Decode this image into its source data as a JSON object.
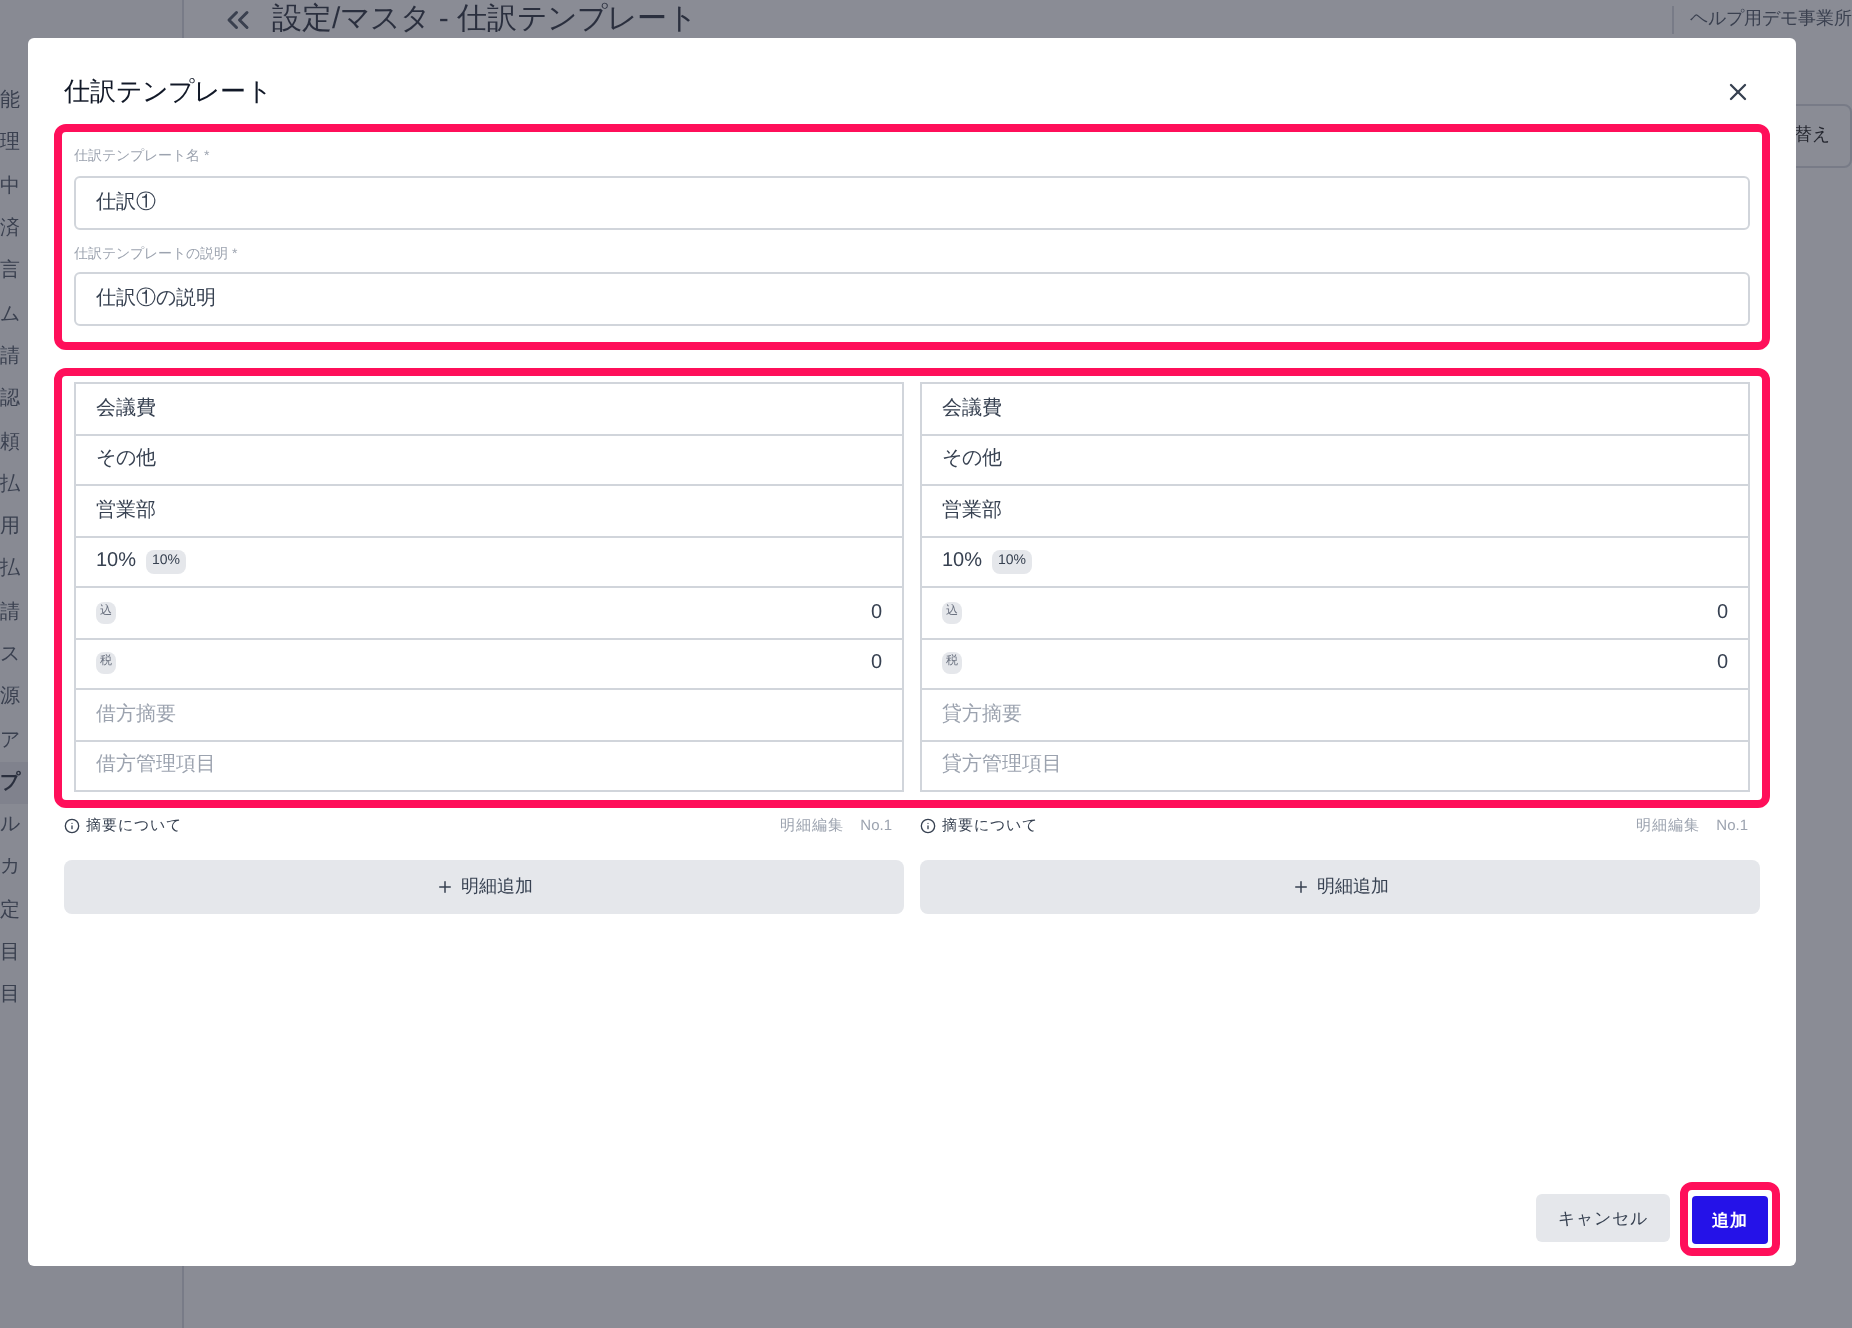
{
  "sidebar": {
    "items": [
      {
        "label": "能",
        "selected": false
      },
      {
        "label": "理",
        "selected": false
      },
      {
        "label": "中",
        "selected": false
      },
      {
        "label": "済",
        "selected": false
      },
      {
        "label": "言",
        "selected": false
      },
      {
        "label": "ム",
        "selected": false
      },
      {
        "label": "請",
        "selected": false
      },
      {
        "label": "認",
        "selected": false
      },
      {
        "label": "頼",
        "selected": false
      },
      {
        "label": "払",
        "selected": false
      },
      {
        "label": "用",
        "selected": false
      },
      {
        "label": "払",
        "selected": false
      },
      {
        "label": "請",
        "selected": false
      },
      {
        "label": "ス",
        "selected": false
      },
      {
        "label": "源",
        "selected": false
      },
      {
        "label": "ア",
        "selected": false
      },
      {
        "label": "プ",
        "selected": true
      },
      {
        "label": "ル",
        "selected": false
      },
      {
        "label": "カ",
        "selected": false
      },
      {
        "label": "定",
        "selected": false
      },
      {
        "label": "目",
        "selected": false
      },
      {
        "label": "目",
        "selected": false
      }
    ]
  },
  "header": {
    "title": "設定/マスタ - 仕訳テンプレート",
    "company": "ヘルプ用デモ事業所",
    "switch_button": "替え"
  },
  "dialog": {
    "title": "仕訳テンプレート",
    "fields": [
      {
        "label": "仕訳テンプレート名 *",
        "value": "仕訳①"
      },
      {
        "label": "仕訳テンプレートの説明 *",
        "value": "仕訳①の説明"
      }
    ],
    "columns": [
      {
        "rows": [
          {
            "kind": "text",
            "text": "会議費"
          },
          {
            "kind": "text",
            "text": "その他"
          },
          {
            "kind": "text",
            "text": "営業部"
          },
          {
            "kind": "tax",
            "text": "10%",
            "badge": "10%"
          },
          {
            "kind": "amount",
            "badge": "込",
            "value": "0"
          },
          {
            "kind": "amount",
            "badge": "税",
            "value": "0"
          },
          {
            "kind": "placeholder",
            "text": "借方摘要"
          },
          {
            "kind": "placeholder",
            "text": "借方管理項目"
          }
        ],
        "note": "摘要について",
        "edit_label": "明細編集",
        "number": "No.1",
        "add_button": "明細追加"
      },
      {
        "rows": [
          {
            "kind": "text",
            "text": "会議費"
          },
          {
            "kind": "text",
            "text": "その他"
          },
          {
            "kind": "text",
            "text": "営業部"
          },
          {
            "kind": "tax",
            "text": "10%",
            "badge": "10%"
          },
          {
            "kind": "amount",
            "badge": "込",
            "value": "0"
          },
          {
            "kind": "amount",
            "badge": "税",
            "value": "0"
          },
          {
            "kind": "placeholder",
            "text": "貸方摘要"
          },
          {
            "kind": "placeholder",
            "text": "貸方管理項目"
          }
        ],
        "note": "摘要について",
        "edit_label": "明細編集",
        "number": "No.1",
        "add_button": "明細追加"
      }
    ],
    "cancel_button": "キャンセル",
    "submit_button": "追加"
  }
}
